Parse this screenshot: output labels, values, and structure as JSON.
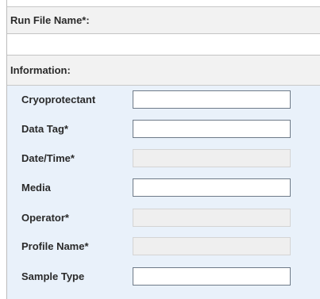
{
  "run_section": {
    "label": "Run File Name*:",
    "value": ""
  },
  "info_section": {
    "label": "Information:"
  },
  "fields": [
    {
      "label": "Cryoprotectant",
      "value": "",
      "enabled": true
    },
    {
      "label": "Data Tag*",
      "value": "",
      "enabled": true
    },
    {
      "label": "Date/Time*",
      "value": "",
      "enabled": false
    },
    {
      "label": "Media",
      "value": "",
      "enabled": true
    },
    {
      "label": "Operator*",
      "value": "",
      "enabled": false
    },
    {
      "label": "Profile Name*",
      "value": "",
      "enabled": false
    },
    {
      "label": "Sample Type",
      "value": "",
      "enabled": true
    }
  ]
}
